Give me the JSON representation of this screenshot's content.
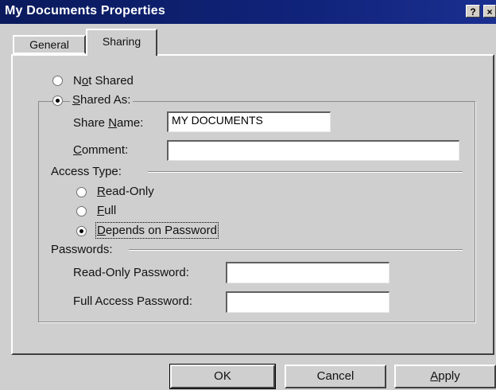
{
  "window": {
    "title": "My Documents Properties",
    "help_label": "?",
    "close_label": "×"
  },
  "tabs": [
    {
      "label": "General"
    },
    {
      "label": "Sharing"
    }
  ],
  "sharing": {
    "not_shared": {
      "label_pre": "N",
      "label_u": "o",
      "label_post": "t Shared",
      "selected": false
    },
    "shared_as": {
      "label_u": "S",
      "label_post": "hared As:",
      "selected": true
    },
    "share_name_label_pre": "Share ",
    "share_name_label_u": "N",
    "share_name_label_post": "ame:",
    "share_name_value": "MY DOCUMENTS",
    "comment_label_u": "C",
    "comment_label_post": "omment:",
    "comment_value": "",
    "access_type_label": "Access Type:",
    "access_read_only": {
      "label_u": "R",
      "label_post": "ead-Only",
      "selected": false
    },
    "access_full": {
      "label_u": "F",
      "label_post": "ull",
      "selected": false
    },
    "access_depends": {
      "label_u": "D",
      "label_post": "epends on Password",
      "selected": true
    },
    "passwords_label": "Passwords:",
    "read_only_password_label": "Read-Only Password:",
    "read_only_password_value": "",
    "full_access_password_label": "Full Access Password:",
    "full_access_password_value": ""
  },
  "buttons": {
    "ok": "OK",
    "cancel": "Cancel",
    "apply_u": "A",
    "apply_post": "pply"
  }
}
